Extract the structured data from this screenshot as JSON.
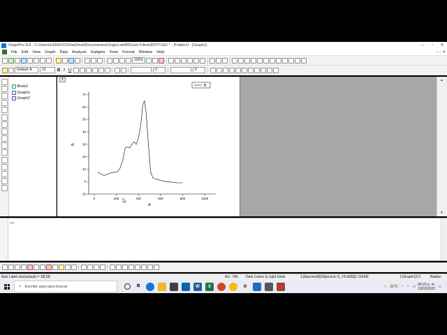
{
  "window": {
    "title": "OriginPro 8.5 - C:\\Users\\LENOVO\\OneDrive\\Documentos\\OriginLab\\85\\User Files\\UNTITLED * - /Folder1/ - [Graph1]",
    "minimize": "–",
    "maximize": "▫",
    "close": "✕"
  },
  "menu": {
    "items": [
      "File",
      "Edit",
      "View",
      "Graph",
      "Data",
      "Analysis",
      "Gadgets",
      "Tools",
      "Format",
      "Window",
      "Help"
    ],
    "mdi_controls": [
      "–",
      "▫",
      "✕"
    ]
  },
  "toolbar": {
    "zoom": "100%",
    "font_name": "Default: A",
    "font_size": "10",
    "bold": "B",
    "italic": "I",
    "underline": "U",
    "line_width": "0",
    "line_width2": "0"
  },
  "project": {
    "items": [
      {
        "type": "sheet",
        "label": "Book2"
      },
      {
        "type": "graph",
        "label": "Graph1"
      },
      {
        "type": "graph",
        "label": "Graph2"
      }
    ]
  },
  "graph": {
    "layer_label": "1",
    "legend_label": "B"
  },
  "chart_data": {
    "type": "line",
    "xlabel": "A",
    "ylabel": "B",
    "xlim": [
      -50,
      1100
    ],
    "ylim": [
      -10,
      72
    ],
    "xticks": [
      0,
      200,
      400,
      600,
      800,
      1000
    ],
    "yticks": [
      -10,
      0,
      10,
      20,
      30,
      40,
      50,
      60,
      70
    ],
    "tick_labels_x": [
      "0",
      "200",
      "400",
      "600",
      "800",
      "1000"
    ],
    "tick_labels_y": [
      "-10",
      "0",
      "10",
      "20",
      "30",
      "40",
      "50",
      "60",
      "70"
    ],
    "grid": false,
    "legend": "top-right",
    "series": [
      {
        "name": "B",
        "x": [
          30,
          60,
          90,
          120,
          150,
          180,
          210,
          230,
          260,
          280,
          300,
          320,
          340,
          360,
          380,
          400,
          420,
          440,
          455,
          470,
          490,
          510,
          530,
          560,
          600,
          650,
          700,
          750,
          800
        ],
        "y": [
          8,
          6,
          5,
          6,
          7,
          7.5,
          8,
          10,
          18,
          27,
          28,
          27,
          30,
          32,
          30,
          35,
          45,
          62,
          65,
          55,
          30,
          8,
          3,
          2,
          1,
          0,
          -0.5,
          -1,
          -1
        ]
      }
    ],
    "color": "#000000"
  },
  "command": {
    "prompt": ">>"
  },
  "status": {
    "left": "Axis Label size(actual) = 18(18)",
    "au": "AU : ON",
    "theme": "Dark Colors & Light Grids",
    "cell": "1:[Ejercicio8]1!Ejercicio 8_1!Col(B)[1:11643]",
    "graph": "1:[Graph1]1!1",
    "unit": "Radian"
  },
  "taskbar": {
    "search_placeholder": "Escribe aquí para buscar",
    "temperature": "21°C",
    "time": "08:22 p. m.",
    "date": "19/03/2022"
  },
  "colors": {
    "mdi_background": "#a7a7a7",
    "taskbar": "#e9ecf2"
  }
}
